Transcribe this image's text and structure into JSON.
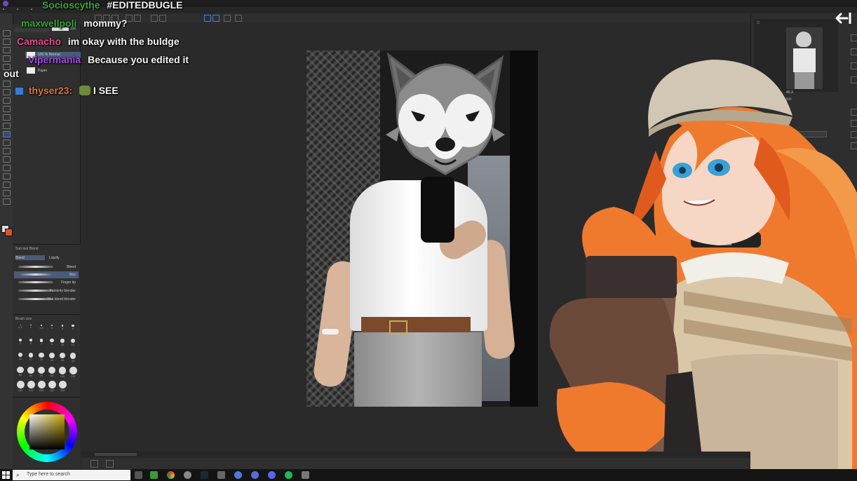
{
  "chat": {
    "messages": [
      {
        "name": "Socioscythe",
        "name_color": "#3aa53a",
        "text": "#EDITEDBUGLE"
      },
      {
        "name": "maxwellpoli",
        "name_color": "#3aa53a",
        "text": "mommy?"
      },
      {
        "name": "Camacho",
        "name_color": "#e24a8f",
        "text": "im okay with the buldge"
      },
      {
        "name": "Vipermania",
        "name_color": "#a24ae2",
        "text": "Because you edited it"
      },
      {
        "name": "",
        "name_color": "#ffffff",
        "text": "out"
      },
      {
        "name": "thyser23:",
        "name_color": "#e2743a",
        "text": "I SEE"
      }
    ]
  },
  "layers": {
    "items": [
      {
        "label": "100 % Normal"
      },
      {
        "label": "Paper"
      }
    ],
    "opacity": "100"
  },
  "subtool": {
    "title": "Sub tool Blend",
    "tabs": [
      "Blend",
      "Liquify"
    ],
    "brushes": [
      "Blend",
      "Blur",
      "Finger tip",
      "Painterly blender",
      "Wet blend blender"
    ]
  },
  "brush_size": {
    "title": "Brush size",
    "values": [
      "0.7",
      "1",
      "1.5",
      "2",
      "3",
      "4",
      "5",
      "6",
      "7",
      "8",
      "10",
      "12",
      "15",
      "17",
      "20",
      "25",
      "30",
      "40",
      "50",
      "60",
      "70",
      "80",
      "100",
      "120",
      "150",
      "170",
      "200",
      "250",
      "300"
    ]
  },
  "status": {
    "zoom": "40.3",
    "angle": "0.0"
  },
  "taskbar": {
    "search_placeholder": "Type here to search"
  },
  "colors": {
    "accent": "#4d7ed8",
    "chat_text": "#f4f4f4"
  }
}
